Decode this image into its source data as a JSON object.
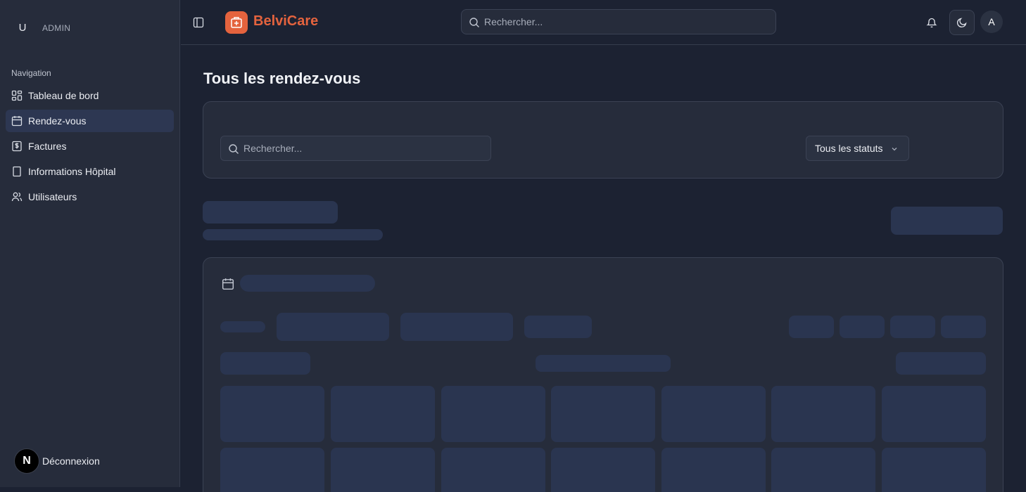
{
  "sidebar": {
    "avatar_initial": "U",
    "role": "ADMIN",
    "section_label": "Navigation",
    "items": [
      {
        "label": "Tableau de bord",
        "icon": "dashboard-icon"
      },
      {
        "label": "Rendez-vous",
        "icon": "calendar-icon",
        "active": true
      },
      {
        "label": "Factures",
        "icon": "invoice-icon"
      },
      {
        "label": "Informations Hôpital",
        "icon": "building-icon"
      },
      {
        "label": "Utilisateurs",
        "icon": "users-icon"
      }
    ],
    "footer": {
      "logo_letter": "N",
      "logout_label": "Déconnexion"
    }
  },
  "header": {
    "brand_name": "BelviCare",
    "search_placeholder": "Rechercher...",
    "user_initial": "A"
  },
  "main": {
    "title": "Tous les rendez-vous",
    "filters": {
      "search_placeholder": "Rechercher...",
      "status_selected": "Tous les statuts"
    }
  },
  "colors": {
    "accent": "#e4633e",
    "background": "#1c2232",
    "sidebar": "#262c3b",
    "active_item": "#2d3752",
    "skeleton": "#2a3550"
  }
}
